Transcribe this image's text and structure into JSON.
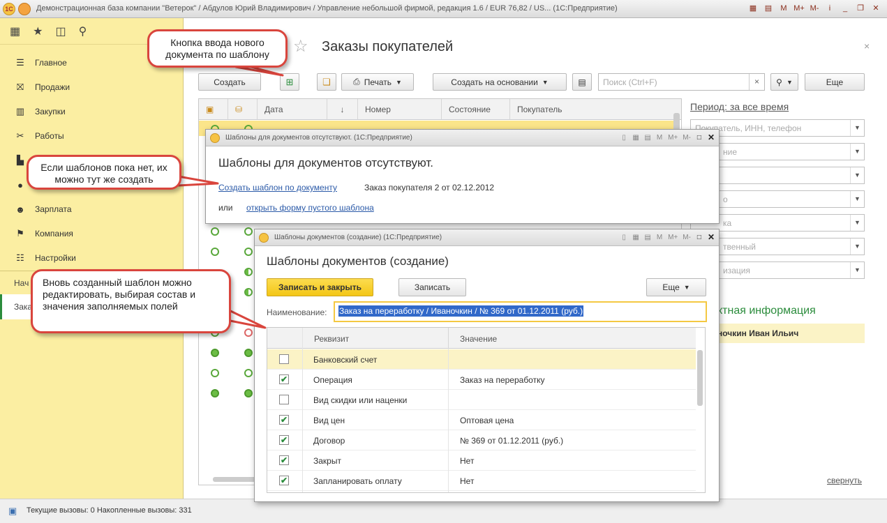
{
  "window": {
    "title": "Демонстрационная база компании \"Ветерок\" / Абдулов Юрий Владимирович / Управление небольшой фирмой, редакция 1.6 / EUR 76,82 / US... (1С:Предприятие)",
    "controls": [
      "M",
      "M+",
      "M-",
      "i"
    ]
  },
  "sidebar": {
    "items": [
      {
        "label": "Главное",
        "icon": "menu-icon"
      },
      {
        "label": "Продажи",
        "icon": "basket-icon"
      },
      {
        "label": "Закупки",
        "icon": "cart-icon"
      },
      {
        "label": "Работы",
        "icon": "tools-icon"
      },
      {
        "label": "",
        "icon": "factory-icon"
      },
      {
        "label": "",
        "icon": "money-icon"
      },
      {
        "label": "Зарплата",
        "icon": "people-icon"
      },
      {
        "label": "Компания",
        "icon": "flag-icon"
      },
      {
        "label": "Настройки",
        "icon": "settings-icon"
      }
    ],
    "sub": [
      "Нач",
      "Зака"
    ]
  },
  "form": {
    "title": "Заказы покупателей",
    "toolbar": {
      "create": "Создать",
      "print": "Печать",
      "create_based": "Создать на основании",
      "more": "Еще"
    },
    "search": {
      "placeholder": "Поиск (Ctrl+F)",
      "clear": "×"
    },
    "table": {
      "columns": [
        "Дата",
        "↓",
        "Номер",
        "Состояние",
        "Покупатель"
      ]
    },
    "period": "Период: за все время",
    "filters": [
      "Покупатель, ИНН, телефон",
      "ние",
      "",
      "о",
      "ка",
      "твенный",
      "изация"
    ],
    "contact_title": "ктная информация",
    "contact_name": "ночкин Иван Ильич",
    "collapse": "свернуть"
  },
  "status_bar": {
    "text": "Текущие вызовы: 0   Накопленные вызовы: 331"
  },
  "dialog_no_templates": {
    "window_title": "Шаблоны для документов отсутствуют.  (1С:Предприятие)",
    "heading": "Шаблоны для документов отсутствуют.",
    "create_link": "Создать шаблон по документу",
    "document": "Заказ покупателя 2 от 02.12.2012",
    "or": "или",
    "open_link": "открыть форму пустого шаблона"
  },
  "dialog_create": {
    "window_title": "Шаблоны документов (создание)  (1С:Предприятие)",
    "heading": "Шаблоны документов (создание)",
    "save_close": "Записать и закрыть",
    "save": "Записать",
    "more": "Еще",
    "name_label": "Наименование:",
    "name_value": "Заказ на переработку / Иваночкин / № 369 от 01.12.2011 (руб.)",
    "columns": [
      "Реквизит",
      "Значение"
    ],
    "rows": [
      {
        "checked": false,
        "attr": "Банковский счет",
        "value": ""
      },
      {
        "checked": true,
        "attr": "Операция",
        "value": "Заказ на переработку"
      },
      {
        "checked": false,
        "attr": "Вид скидки или наценки",
        "value": ""
      },
      {
        "checked": true,
        "attr": "Вид цен",
        "value": "Оптовая цена"
      },
      {
        "checked": true,
        "attr": "Договор",
        "value": "№ 369 от 01.12.2011 (руб.)"
      },
      {
        "checked": true,
        "attr": "Закрыт",
        "value": "Нет"
      },
      {
        "checked": true,
        "attr": "Запланировать оплату",
        "value": "Нет"
      }
    ]
  },
  "callouts": {
    "template_button": "Кнопка ввода нового документа по шаблону",
    "no_templates": "Если шаблонов пока нет, их можно тут же создать",
    "edit_template": "Вновь созданный шаблон можно редактировать, выбирая состав и значения заполняемых полей"
  }
}
